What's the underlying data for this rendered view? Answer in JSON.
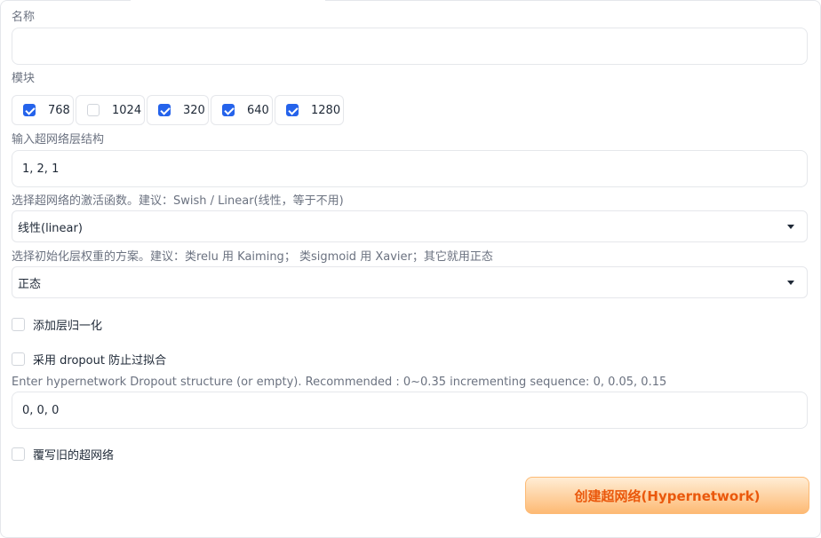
{
  "name_field": {
    "label": "名称",
    "value": ""
  },
  "modules": {
    "label": "模块",
    "options": [
      {
        "label": "768",
        "checked": true
      },
      {
        "label": "1024",
        "checked": false
      },
      {
        "label": "320",
        "checked": true
      },
      {
        "label": "640",
        "checked": true
      },
      {
        "label": "1280",
        "checked": true
      }
    ]
  },
  "layer_structure": {
    "label": "输入超网络层结构",
    "value": "1, 2, 1"
  },
  "activation": {
    "label": "选择超网络的激活函数。建议：Swish / Linear(线性，等于不用)",
    "selected": "线性(linear)"
  },
  "init": {
    "label": "选择初始化层权重的方案。建议：类relu 用 Kaiming； 类sigmoid 用 Xavier；其它就用正态",
    "selected": "正态"
  },
  "layer_norm": {
    "label": "添加层归一化",
    "checked": false
  },
  "use_dropout": {
    "label": "采用 dropout 防止过拟合",
    "checked": false
  },
  "dropout_structure": {
    "label": "Enter hypernetwork Dropout structure (or empty). Recommended : 0~0.35 incrementing sequence: 0, 0.05, 0.15",
    "value": "0, 0, 0"
  },
  "overwrite": {
    "label": "覆写旧的超网络",
    "checked": false
  },
  "create_button": {
    "label": "创建超网络(Hypernetwork)"
  },
  "colors": {
    "accent": "#2563eb",
    "button_text": "#ea580c",
    "button_bg": "#fdba74"
  }
}
